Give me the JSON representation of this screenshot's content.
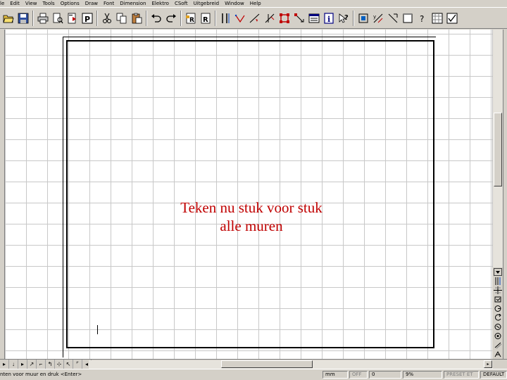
{
  "menu": [
    "le",
    "Edit",
    "View",
    "Tools",
    "Options",
    "Draw",
    "Font",
    "Dimension",
    "Elektro",
    "CSoft",
    "Uitgebreid",
    "Window",
    "Help"
  ],
  "toolbar_icons": [
    "open-folder-icon",
    "save-icon",
    "print-icon",
    "print-preview-icon",
    "export-icon",
    "layout-icon",
    "cut-icon",
    "copy-icon",
    "paste-icon",
    "undo-icon",
    "redo-icon",
    "reference-icon",
    "redraw-icon",
    "parallel-lines-icon",
    "angle-icon",
    "line-tool-icon",
    "trim-icon",
    "rectangle-select-icon",
    "measure-icon",
    "properties-icon",
    "info-icon",
    "help-pointer-icon",
    "zoom-window-icon",
    "coordinates-icon",
    "snap-icon",
    "frame-icon",
    "question-icon",
    "grid-icon",
    "check-icon"
  ],
  "canvas": {
    "caption_line1": "Teken nu stuk voor stuk",
    "caption_line2": "alle muren"
  },
  "right_tools": [
    "scroll-down-icon",
    "wall-tool-icon",
    "grid-snap-icon",
    "rotate-icon",
    "circle-arc-icon",
    "copy-rotate-icon",
    "mirror-icon",
    "target-icon",
    "offset-icon",
    "text-icon"
  ],
  "nav_icons": [
    "nav-first-icon",
    "nav-prev-icon",
    "nav-next-icon",
    "nav-last-icon",
    "nav-home-icon",
    "nav-up-icon",
    "nav-add-icon",
    "nav-remove-icon",
    "nav-mark-icon",
    "nav-end-icon"
  ],
  "status": {
    "prompt": "nten voor muur en druk <Enter>",
    "units": "mm",
    "mode": "OFF",
    "value": "0",
    "zoom": "9%",
    "preset": "PRESET ET",
    "layer": "DEFAULT"
  },
  "colors": {
    "caption": "#c00000",
    "grid": "#c8c8c8",
    "chrome": "#d4d0c8"
  }
}
